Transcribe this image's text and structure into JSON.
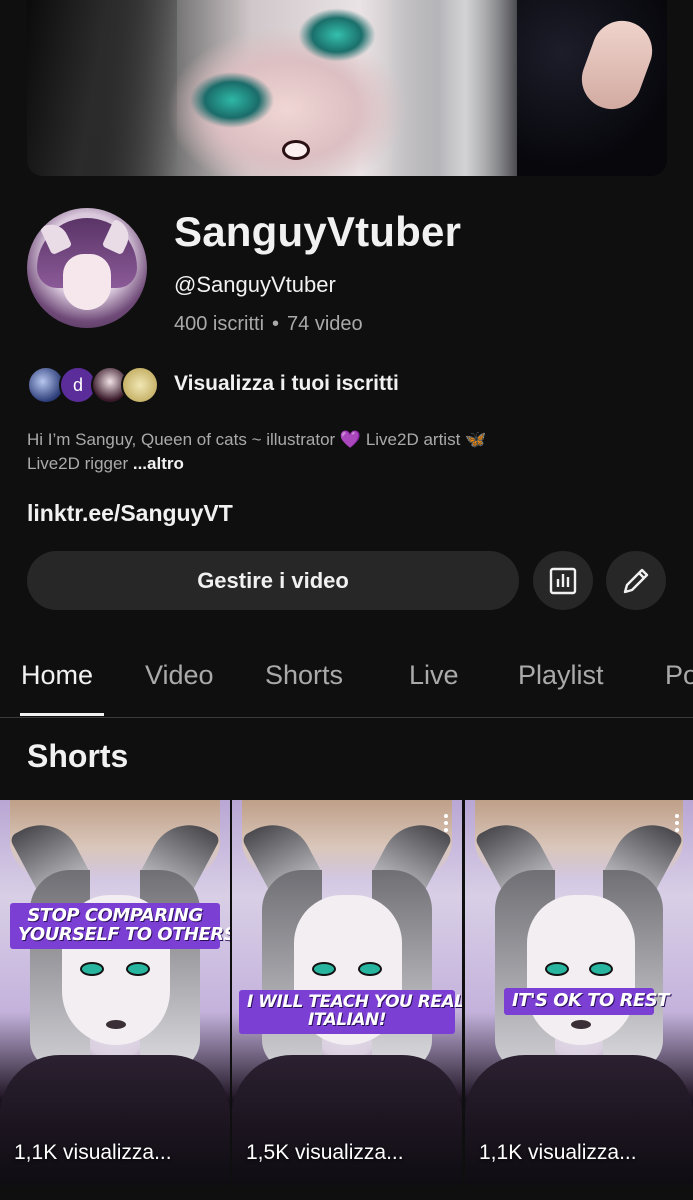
{
  "channel": {
    "name": "SanguyVtuber",
    "handle": "@SanguyVtuber",
    "subscribers": "400 iscritti",
    "separator": "•",
    "videos": "74 video",
    "subscribers_link": "Visualizza i tuoi iscritti",
    "subscriber_initial": "d",
    "description_text": "Hi I’m Sanguy, Queen of cats ~ illustrator",
    "description_heart": "💜",
    "description_text2": "Live2D artist",
    "description_butterfly": "🦋",
    "description_text3": "Live2D rigger",
    "description_more": "...altro",
    "link": "linktr.ee/SanguyVT"
  },
  "actions": {
    "manage_label": "Gestire i video",
    "stats_icon": "bar-chart-icon",
    "edit_icon": "pencil-icon"
  },
  "tabs": [
    {
      "label": "Home",
      "active": true
    },
    {
      "label": "Video"
    },
    {
      "label": "Shorts"
    },
    {
      "label": "Live"
    },
    {
      "label": "Playlist"
    },
    {
      "label": "Po"
    }
  ],
  "shorts_section": {
    "title": "Shorts",
    "items": [
      {
        "caption_line1": "Stop comparing",
        "caption_line2": "yourself to others",
        "views": "1,1K visualizza..."
      },
      {
        "caption_line1": "I will teach you real",
        "caption_line2": "Italian!",
        "views": "1,5K visualizza..."
      },
      {
        "caption_line1": "It's ok to rest",
        "caption_line2": "",
        "views": "1,1K visualizza..."
      }
    ]
  },
  "colors": {
    "background": "#0f0f0f",
    "button_bg": "#272727",
    "secondary_text": "#aaaaaa",
    "caption_purple": "#7b3fd4"
  }
}
